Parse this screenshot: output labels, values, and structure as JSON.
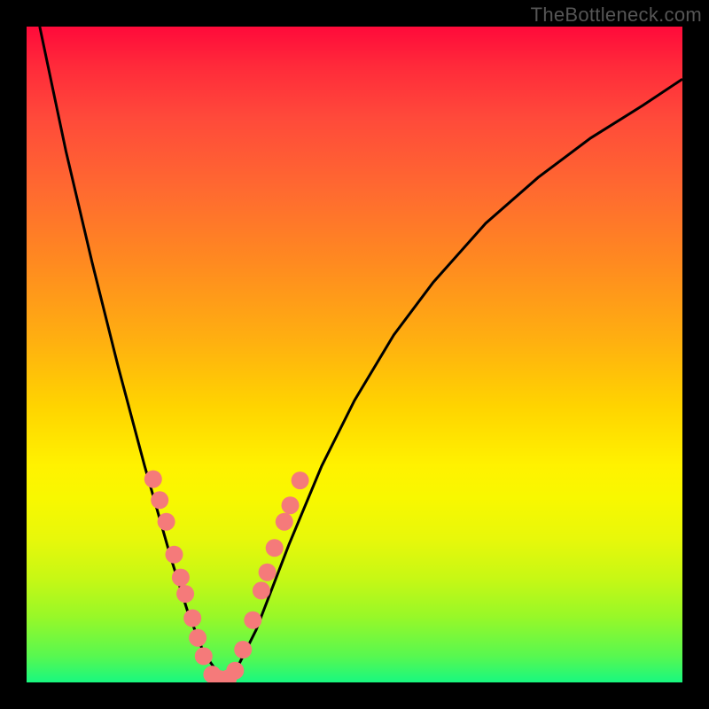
{
  "watermark": "TheBottleneck.com",
  "chart_data": {
    "type": "line",
    "title": "",
    "xlabel": "",
    "ylabel": "",
    "xlim": [
      0,
      1
    ],
    "ylim": [
      0,
      1
    ],
    "grid": false,
    "series": [
      {
        "name": "bottleneck-curve",
        "color": "#000000",
        "x": [
          0.02,
          0.06,
          0.1,
          0.14,
          0.18,
          0.22,
          0.245,
          0.27,
          0.295,
          0.32,
          0.35,
          0.4,
          0.45,
          0.5,
          0.56,
          0.62,
          0.7,
          0.78,
          0.86,
          0.94,
          1.0
        ],
        "y": [
          1.0,
          0.81,
          0.64,
          0.48,
          0.33,
          0.19,
          0.11,
          0.045,
          0.01,
          0.02,
          0.08,
          0.21,
          0.33,
          0.43,
          0.53,
          0.61,
          0.7,
          0.77,
          0.83,
          0.88,
          0.92
        ]
      }
    ],
    "markers": [
      {
        "name": "salmon-dots",
        "color": "#f57a7a",
        "radius_px": 10,
        "points": [
          {
            "x": 0.193,
            "y": 0.31
          },
          {
            "x": 0.203,
            "y": 0.278
          },
          {
            "x": 0.213,
            "y": 0.245
          },
          {
            "x": 0.225,
            "y": 0.195
          },
          {
            "x": 0.235,
            "y": 0.16
          },
          {
            "x": 0.242,
            "y": 0.135
          },
          {
            "x": 0.253,
            "y": 0.098
          },
          {
            "x": 0.261,
            "y": 0.068
          },
          {
            "x": 0.27,
            "y": 0.04
          },
          {
            "x": 0.283,
            "y": 0.012
          },
          {
            "x": 0.295,
            "y": 0.005
          },
          {
            "x": 0.307,
            "y": 0.006
          },
          {
            "x": 0.318,
            "y": 0.018
          },
          {
            "x": 0.33,
            "y": 0.05
          },
          {
            "x": 0.345,
            "y": 0.095
          },
          {
            "x": 0.358,
            "y": 0.14
          },
          {
            "x": 0.367,
            "y": 0.168
          },
          {
            "x": 0.378,
            "y": 0.205
          },
          {
            "x": 0.393,
            "y": 0.245
          },
          {
            "x": 0.402,
            "y": 0.27
          },
          {
            "x": 0.417,
            "y": 0.308
          }
        ]
      }
    ]
  }
}
